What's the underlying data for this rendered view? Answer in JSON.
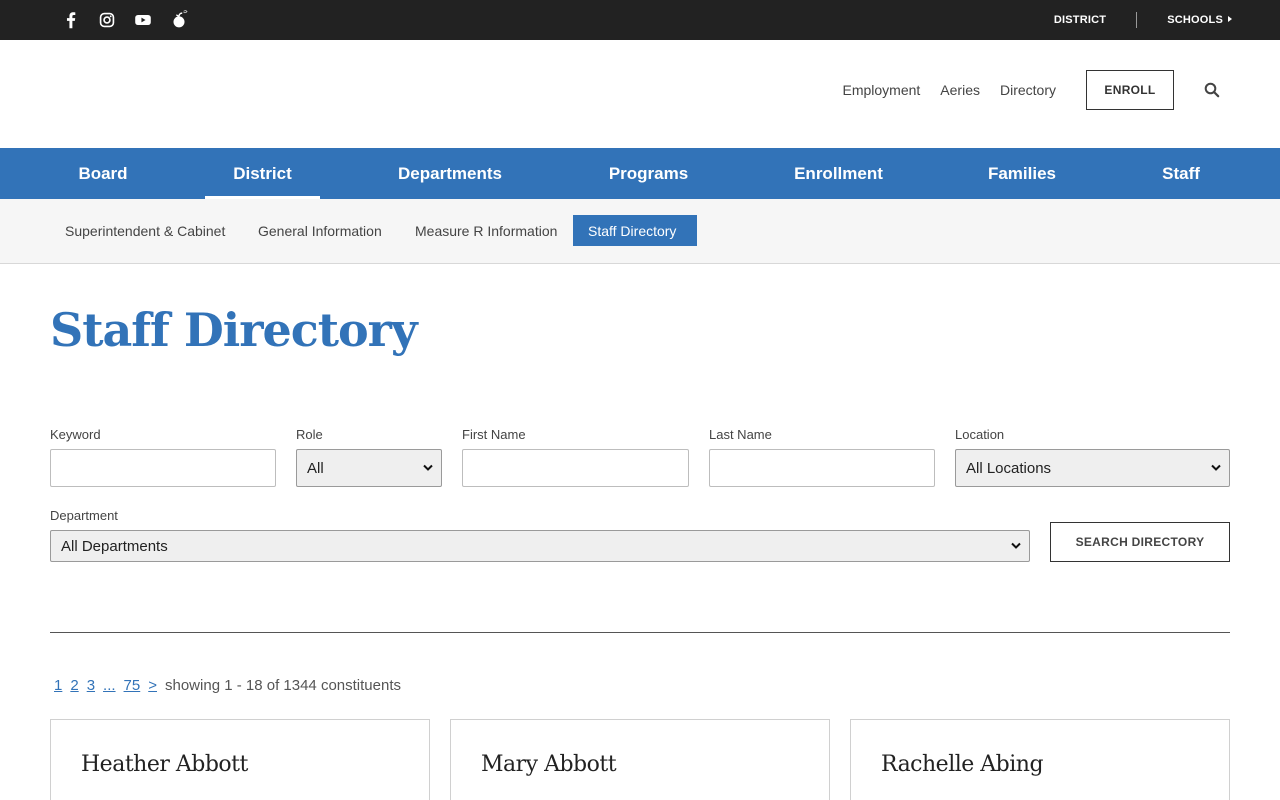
{
  "topbar": {
    "social": [
      {
        "icon": "facebook-icon"
      },
      {
        "icon": "instagram-icon"
      },
      {
        "icon": "youtube-icon"
      },
      {
        "icon": "peachjar-icon"
      }
    ],
    "district_label": "DISTRICT",
    "schools_label": "SCHOOLS"
  },
  "header": {
    "links": [
      "Employment",
      "Aeries",
      "Directory"
    ],
    "enroll_label": "ENROLL"
  },
  "main_nav": {
    "items": [
      {
        "label": "Board"
      },
      {
        "label": "District"
      },
      {
        "label": "Departments"
      },
      {
        "label": "Programs"
      },
      {
        "label": "Enrollment"
      },
      {
        "label": "Families"
      },
      {
        "label": "Staff"
      }
    ],
    "active_index": 1
  },
  "sub_nav": {
    "items": [
      {
        "label": "Superintendent & Cabinet"
      },
      {
        "label": "General Information"
      },
      {
        "label": "Measure R Information"
      },
      {
        "label": "Staff Directory"
      }
    ],
    "active_index": 3
  },
  "page": {
    "title": "Staff Directory"
  },
  "filters": {
    "keyword": {
      "label": "Keyword",
      "value": ""
    },
    "role": {
      "label": "Role",
      "selected": "All"
    },
    "first_name": {
      "label": "First Name",
      "value": ""
    },
    "last_name": {
      "label": "Last Name",
      "value": ""
    },
    "location": {
      "label": "Location",
      "selected": "All Locations"
    },
    "department": {
      "label": "Department",
      "selected": "All Departments"
    },
    "search_label": "SEARCH DIRECTORY"
  },
  "pager": {
    "pages": [
      "1",
      "2",
      "3",
      "...",
      "75",
      ">"
    ],
    "showing": "showing 1 - 18 of 1344 constituents"
  },
  "results": [
    {
      "name": "Heather Abbott"
    },
    {
      "name": "Mary Abbott"
    },
    {
      "name": "Rachelle Abing"
    }
  ],
  "colors": {
    "brand_blue": "#3273b8",
    "topbar_bg": "#222222",
    "subnav_bg": "#f6f6f6"
  }
}
